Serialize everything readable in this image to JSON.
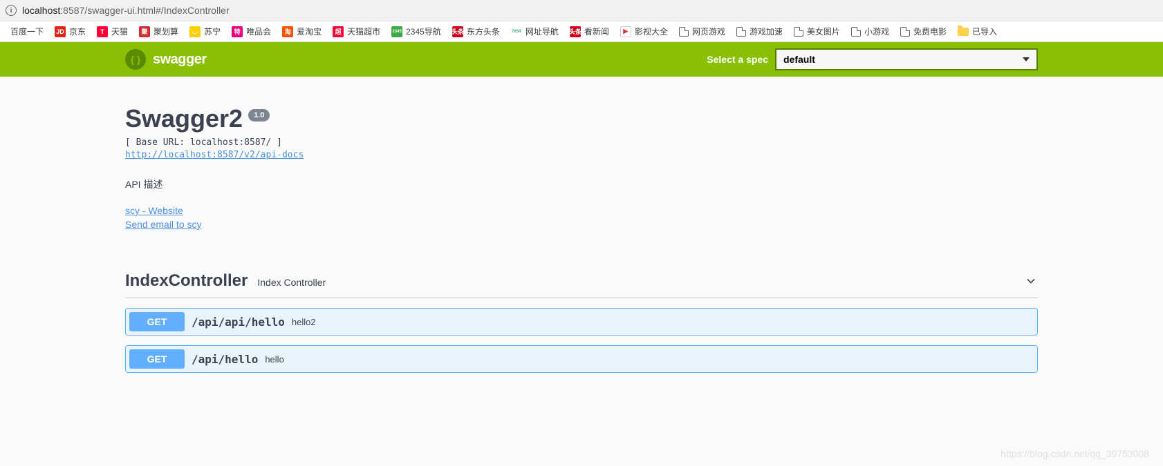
{
  "browser": {
    "url_host": "localhost",
    "url_port": ":8587",
    "url_path": "/swagger-ui.html#/IndexController"
  },
  "bookmarks": [
    {
      "label": "百度一下",
      "icon_text": "",
      "icon_type": "none"
    },
    {
      "label": "京东",
      "icon_text": "JD",
      "bg": "#e1251b"
    },
    {
      "label": "天猫",
      "icon_text": "T",
      "bg": "#ff0036"
    },
    {
      "label": "聚划算",
      "icon_text": "聚",
      "bg": "#d42c2c"
    },
    {
      "label": "苏宁",
      "icon_text": "◡",
      "bg": "#ffd000"
    },
    {
      "label": "唯品会",
      "icon_text": "特",
      "bg": "#e6007e"
    },
    {
      "label": "爱淘宝",
      "icon_text": "淘",
      "bg": "#ff5000"
    },
    {
      "label": "天猫超市",
      "icon_text": "超",
      "bg": "#ff0036"
    },
    {
      "label": "2345导航",
      "icon_text": "2345",
      "bg": "#3da944"
    },
    {
      "label": "东方头条",
      "icon_text": "头条",
      "bg": "#d0021b"
    },
    {
      "label": "网址导航",
      "icon_text": "7654",
      "bg": "#fff",
      "color": "#4a9"
    },
    {
      "label": "看新闻",
      "icon_text": "头条",
      "bg": "#d0021b"
    },
    {
      "label": "影视大全",
      "icon_text": "▶",
      "bg": "#fff",
      "color": "#d33",
      "border": true
    },
    {
      "label": "网页游戏",
      "icon_type": "page"
    },
    {
      "label": "游戏加速",
      "icon_type": "page"
    },
    {
      "label": "美女图片",
      "icon_type": "page"
    },
    {
      "label": "小游戏",
      "icon_type": "page"
    },
    {
      "label": "免费电影",
      "icon_type": "page"
    },
    {
      "label": "已导入",
      "icon_type": "folder"
    }
  ],
  "topbar": {
    "logo_text": "swagger",
    "spec_label": "Select a spec",
    "spec_value": "default"
  },
  "info": {
    "title": "Swagger2",
    "version": "1.0",
    "base_url_line": "[ Base URL: localhost:8587/ ]",
    "api_docs_url": "http://localhost:8587/v2/api-docs",
    "description": "API 描述",
    "contact_website": "scy - Website",
    "contact_email": "Send email to scy"
  },
  "tag": {
    "name": "IndexController",
    "description": "Index Controller"
  },
  "operations": [
    {
      "method": "GET",
      "path": "/api/api/hello",
      "summary": "hello2"
    },
    {
      "method": "GET",
      "path": "/api/hello",
      "summary": "hello"
    }
  ],
  "watermark": "https://blog.csdn.net/qq_39753008"
}
